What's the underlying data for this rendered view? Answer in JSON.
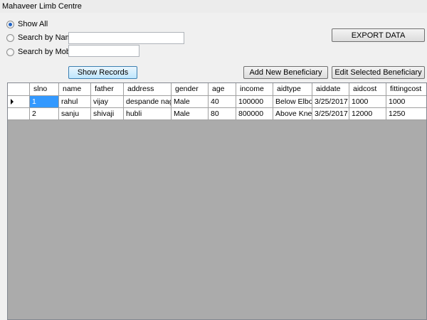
{
  "window": {
    "title": "Mahaveer Limb Centre"
  },
  "search": {
    "show_all_label": "Show All",
    "by_name_label": "Search by Name",
    "by_mobile_label": "Search by Mobile",
    "name_value": "",
    "mobile_value": "",
    "selected": "show_all"
  },
  "buttons": {
    "export": "EXPORT DATA",
    "show_records": "Show Records",
    "add_new": "Add New Beneficiary",
    "edit_selected": "Edit Selected Beneficiary"
  },
  "grid": {
    "columns": [
      "slno",
      "name",
      "father",
      "address",
      "gender",
      "age",
      "income",
      "aidtype",
      "aiddate",
      "aidcost",
      "fittingcost"
    ],
    "rows": [
      [
        "1",
        "rahul",
        "vijay",
        "despande nagar",
        "Male",
        "40",
        "100000",
        "Below Elbow",
        "3/25/2017",
        "1000",
        "1000"
      ],
      [
        "2",
        "sanju",
        "shivaji",
        "hubli",
        "Male",
        "80",
        "800000",
        "Above Knee",
        "3/25/2017",
        "12000",
        "1250"
      ]
    ]
  }
}
